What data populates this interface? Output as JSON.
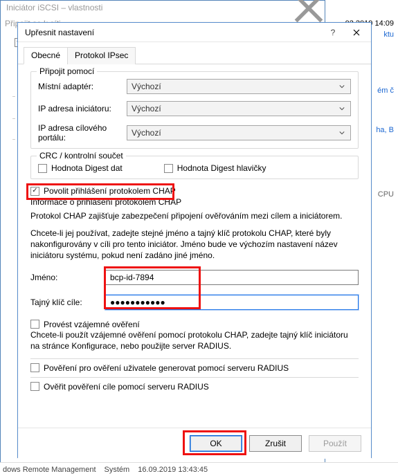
{
  "background": {
    "top_window_title": "Iniciátor iSCSI – vlastnosti",
    "sub_title": "Připojit se k síti",
    "right_fragments": {
      "time": "02.2019 14:09",
      "aktua": "ktu",
      "em_c": "ém č",
      "ha_b": "ha, B",
      "cpu": "CPU"
    },
    "taskbar": {
      "service": "dows Remote Management",
      "acct": "Systém",
      "time": "16.09.2019 13:43:45"
    }
  },
  "dialog": {
    "title": "Upřesnit nastavení",
    "help_icon": "?",
    "close_icon": "×",
    "tabs": {
      "general": "Obecné",
      "ipsec": "Protokol IPsec"
    }
  },
  "connect_group": {
    "title": "Připojit pomocí",
    "local_adapter": "Místní adaptér:",
    "initiator_ip": "IP adresa iniciátoru:",
    "target_ip": "IP adresa cílového portálu:",
    "default_value": "Výchozí"
  },
  "crc_group": {
    "title": "CRC / kontrolní součet",
    "data_digest": "Hodnota Digest dat",
    "header_digest": "Hodnota Digest hlavičky"
  },
  "chap": {
    "enable_label": "Povolit přihlášení protokolem CHAP",
    "info_title": "Informace o přihlášení protokolem CHAP",
    "desc": "Protokol CHAP zajišťuje zabezpečení připojení ověřováním mezi cílem a iniciátorem.",
    "note": "Chcete-li jej používat, zadejte stejné jméno a tajný klíč protokolu CHAP, které byly nakonfigurovány v cíli pro tento iniciátor. Jméno bude ve výchozím nastavení název iniciátoru systému, pokud není zadáno jiné jméno.",
    "name_label": "Jméno:",
    "name_value": "bcp-id-7894",
    "secret_label": "Tajný klíč cíle:",
    "secret_value": "●●●●●●●●●●●",
    "mutual_label": "Provést vzájemné ověření",
    "mutual_note": "Chcete-li použít vzájemné ověření pomocí protokolu CHAP, zadejte tajný klíč iniciátoru na stránce Konfigurace, nebo použijte server RADIUS.",
    "radius_gen": "Pověření pro ověření uživatele generovat pomocí serveru RADIUS",
    "radius_auth": "Ověřit pověření cíle pomocí serveru RADIUS"
  },
  "buttons": {
    "ok": "OK",
    "cancel": "Zrušit",
    "apply": "Použít"
  }
}
